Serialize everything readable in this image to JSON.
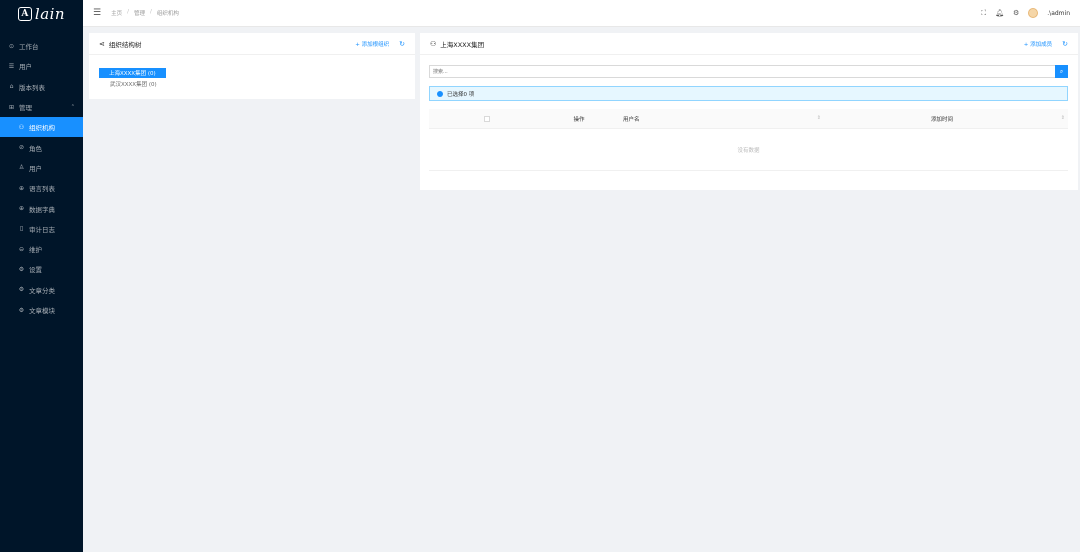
{
  "app": {
    "logo_mark": "A",
    "logo_text": "lain"
  },
  "sidebar": {
    "items": [
      {
        "label": "工作台",
        "icon": "dashboard-icon",
        "glyph": "⊙",
        "level": 0
      },
      {
        "label": "用户",
        "icon": "list-icon",
        "glyph": "☰",
        "level": 0
      },
      {
        "label": "版本列表",
        "icon": "home-icon",
        "glyph": "⌂",
        "level": 0
      },
      {
        "label": "管理",
        "icon": "grid-icon",
        "glyph": "⊞",
        "level": 0,
        "expanded": true
      },
      {
        "label": "组织机构",
        "icon": "team-icon",
        "glyph": "⚇",
        "level": 1,
        "active": true
      },
      {
        "label": "角色",
        "icon": "shield-icon",
        "glyph": "⊘",
        "level": 1
      },
      {
        "label": "用户",
        "icon": "user-icon",
        "glyph": "♙",
        "level": 1
      },
      {
        "label": "语言列表",
        "icon": "globe-icon",
        "glyph": "⊕",
        "level": 1
      },
      {
        "label": "数据字典",
        "icon": "globe-icon",
        "glyph": "⊕",
        "level": 1
      },
      {
        "label": "审计日志",
        "icon": "file-icon",
        "glyph": "▯",
        "level": 1
      },
      {
        "label": "维护",
        "icon": "lock-icon",
        "glyph": "⊖",
        "level": 1
      },
      {
        "label": "设置",
        "icon": "gear-icon",
        "glyph": "⚙",
        "level": 1
      },
      {
        "label": "文章分类",
        "icon": "gear-icon",
        "glyph": "⚙",
        "level": 1
      },
      {
        "label": "文章模块",
        "icon": "gear-icon",
        "glyph": "⚙",
        "level": 1
      }
    ]
  },
  "header": {
    "breadcrumb": [
      "主页",
      "管理",
      "组织机构"
    ],
    "separator": "/",
    "username": ".\\admin"
  },
  "left_panel": {
    "title": "组织结构树",
    "add_label": "+ 添加根组织",
    "tree": [
      {
        "label": "上海XXXX集团 (0)",
        "selected": true
      },
      {
        "label": "武汉XXXX集团 (0)",
        "selected": false
      }
    ]
  },
  "right_panel": {
    "title": "上海XXXX集团",
    "add_label": "+ 添加成员",
    "search_placeholder": "搜索...",
    "selected_text": "已选择0 项",
    "columns": {
      "op": "操作",
      "user": "用户名",
      "time": "添加时间"
    },
    "empty_text": "没有数据"
  },
  "colors": {
    "primary": "#1890ff",
    "sidebar_bg": "#001529"
  }
}
